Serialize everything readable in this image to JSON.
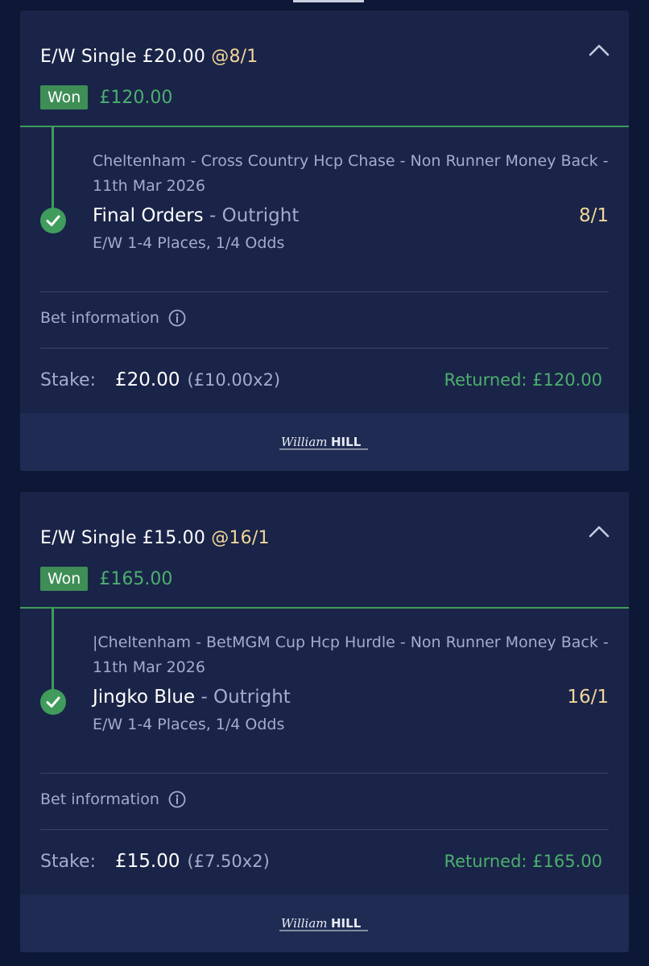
{
  "bets": [
    {
      "title_prefix": "E/W Single £20.00 ",
      "title_odds": "@8/1",
      "status": "Won",
      "won_amount": "£120.00",
      "event": "Cheltenham - Cross Country Hcp Chase - Non Runner Money Back - 11th Mar 2026",
      "selection": "Final Orders",
      "market": " - Outright",
      "odds": "8/1",
      "ew_terms": "E/W 1-4 Places, 1/4 Odds",
      "bet_info_label": "Bet information",
      "stake_label": "Stake:",
      "stake_amount": "£20.00",
      "stake_split": "(£10.00x2)",
      "returned": "Returned: £120.00",
      "logo": "William HILL"
    },
    {
      "title_prefix": "E/W Single £15.00 ",
      "title_odds": "@16/1",
      "status": "Won",
      "won_amount": "£165.00",
      "event": "|Cheltenham - BetMGM Cup Hcp Hurdle - Non Runner Money Back - 11th Mar 2026",
      "selection": "Jingko Blue",
      "market": " - Outright",
      "odds": "16/1",
      "ew_terms": "E/W 1-4 Places, 1/4 Odds",
      "bet_info_label": "Bet information",
      "stake_label": "Stake:",
      "stake_amount": "£15.00",
      "stake_split": "(£7.50x2)",
      "returned": "Returned: £165.00",
      "logo": "William HILL"
    }
  ],
  "icons": {
    "collapse": "chevron-up-icon",
    "check": "check-circle-icon",
    "info": "info-icon"
  },
  "colors": {
    "background": "#0d1836",
    "card": "#1a2448",
    "won_green": "#3e8e56",
    "returned_green": "#4caf6e",
    "odds_gold": "#f2d59a"
  }
}
